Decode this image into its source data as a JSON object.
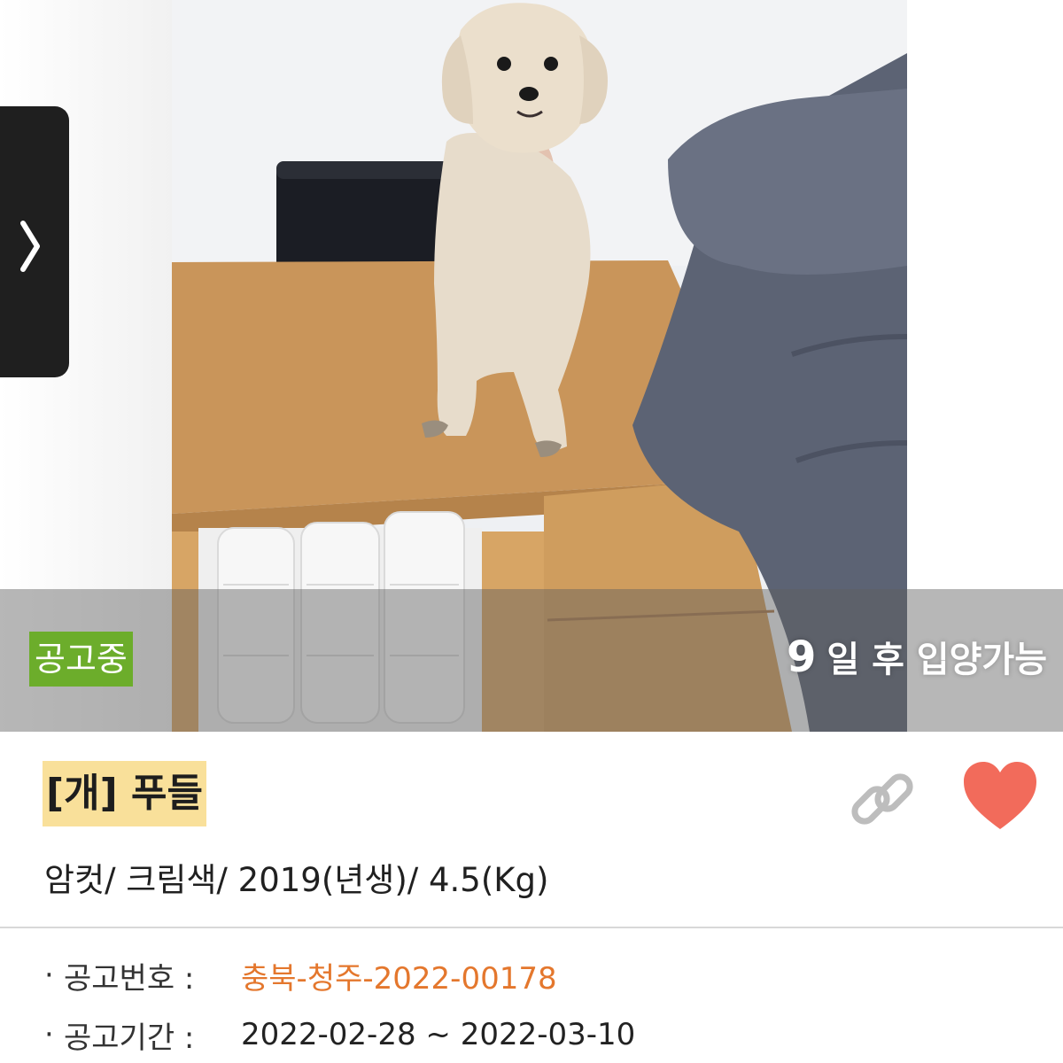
{
  "status": {
    "badge": "공고중",
    "adopt_days": "9",
    "adopt_suffix": "일 후 입양가능"
  },
  "animal": {
    "title": "[개] 푸들",
    "summary": "암컷/ 크림색/ 2019(년생)/ 4.5(Kg)"
  },
  "details": [
    {
      "bullet": "·",
      "label": "공고번호 :",
      "value": "충북-청주-2022-00178"
    },
    {
      "bullet": "·",
      "label": "공고기간 :",
      "value": "2022-02-28 ~ 2022-03-10"
    }
  ],
  "icons": {
    "prev": "chevron-right-icon",
    "link": "link-icon",
    "favorite": "heart-icon"
  },
  "colors": {
    "badge_bg": "#6cad2b",
    "title_highlight": "#f9e09a",
    "notice_number": "#e4772d",
    "heart": "#f26b5b"
  }
}
